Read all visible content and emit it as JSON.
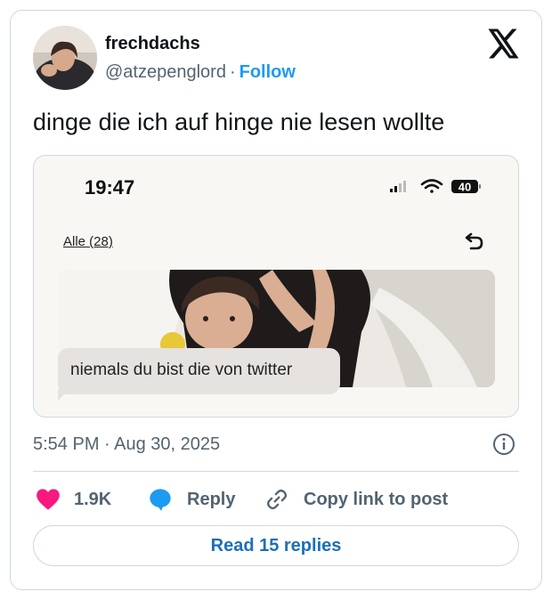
{
  "author": {
    "display_name": "frechdachs",
    "handle": "@atzepenglord",
    "separator": "·",
    "follow_label": "Follow"
  },
  "tweet": {
    "text": "dinge die ich auf hinge nie lesen wollte",
    "timestamp": "5:54 PM · Aug 30, 2025"
  },
  "media": {
    "phone_time": "19:47",
    "battery_level": "40",
    "alle_label": "Alle (28)",
    "message_bubble": "niemals du bist die von twitter"
  },
  "actions": {
    "like_count": "1.9K",
    "reply_label": "Reply",
    "copy_link_label": "Copy link to post"
  },
  "read_replies_label": "Read 15 replies",
  "colors": {
    "accent_blue": "#1d9bf0",
    "heart_pink": "#f91880",
    "text_primary": "#0f1419",
    "text_secondary": "#536471",
    "border": "#cfd9de"
  },
  "icons": [
    "x-logo-icon",
    "signal-icon",
    "wifi-icon",
    "battery-icon",
    "reply-arrow-icon",
    "info-icon",
    "heart-icon",
    "chat-bubble-icon",
    "link-icon"
  ]
}
